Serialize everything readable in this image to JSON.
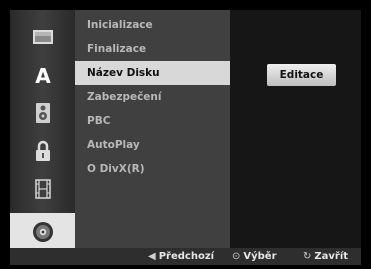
{
  "sidebar": {
    "icons": [
      "film-icon",
      "language-icon",
      "speaker-icon",
      "lock-icon",
      "filmstrip-icon",
      "disc-icon"
    ],
    "active": "disc-icon"
  },
  "menu": {
    "items": [
      {
        "label": "Inicializace"
      },
      {
        "label": "Finalizace"
      },
      {
        "label": "Název Disku"
      },
      {
        "label": "Zabezpečení"
      },
      {
        "label": "PBC"
      },
      {
        "label": "AutoPlay"
      },
      {
        "label": "O DivX(R)"
      }
    ],
    "selected": "Název Disku"
  },
  "panel": {
    "edit_label": "Editace"
  },
  "footer": {
    "prev_label": "Předchozí",
    "select_label": "Výběr",
    "close_label": "Zavřít"
  },
  "colors": {
    "background": "#000000",
    "sidebar": "#3a3a3a",
    "menu": "#404040",
    "selected": "#d8d8d8",
    "panel": "#161616",
    "footer": "#2e2e2e"
  }
}
